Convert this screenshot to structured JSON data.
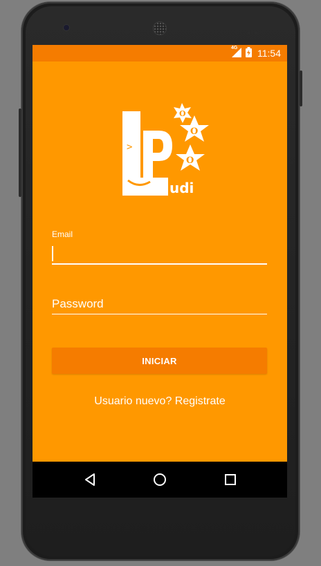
{
  "status_bar": {
    "network": "4G",
    "time": "11:54",
    "background": "#F57C00"
  },
  "logo": {
    "alt": "Ludi LPOO logo",
    "letters": [
      "L",
      "P",
      "O",
      "O"
    ],
    "subtext": "udi",
    "prompt": ">"
  },
  "form": {
    "email_label": "Email",
    "email_value": "",
    "password_placeholder": "Password",
    "password_value": ""
  },
  "actions": {
    "login_label": "INICIAR",
    "register_label": "Usuario nuevo? Registrate"
  },
  "nav": {
    "back": "back-icon",
    "home": "home-icon",
    "recents": "recents-icon"
  },
  "colors": {
    "screen_bg": "#FF9800",
    "accent": "#F57C00",
    "text": "#FFFFFF"
  }
}
